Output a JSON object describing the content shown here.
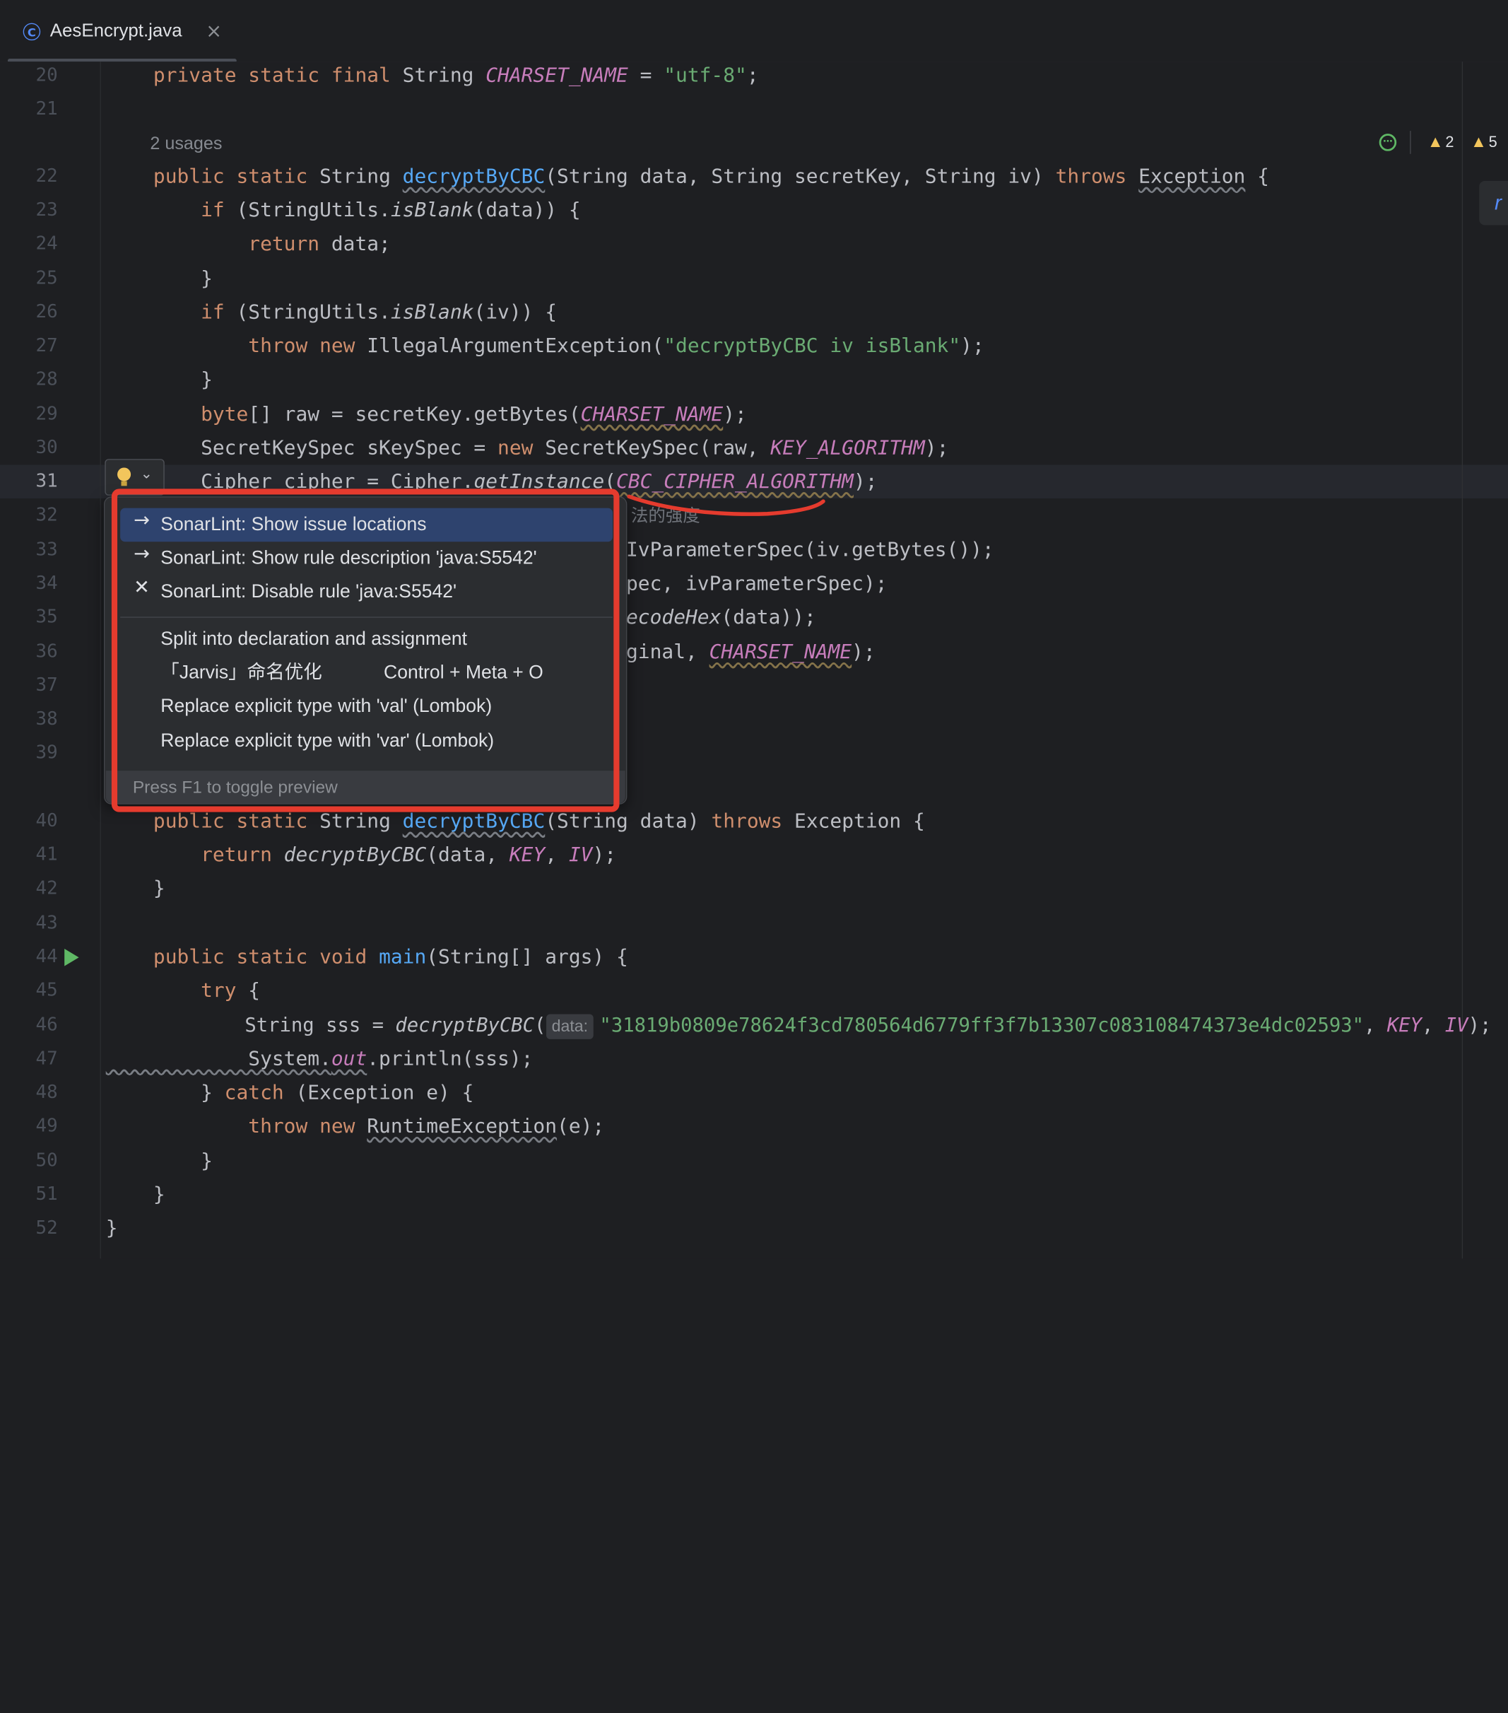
{
  "tab": {
    "title": "AesEncrypt.java",
    "icon": "java-class-icon",
    "close": "×"
  },
  "status": {
    "warnings": "2",
    "weak_warnings": "5"
  },
  "line_numbers": [
    "20",
    "21",
    "22",
    "23",
    "24",
    "25",
    "26",
    "27",
    "28",
    "29",
    "30",
    "31",
    "32",
    "33",
    "34",
    "35",
    "36",
    "37",
    "38",
    "39",
    "40",
    "41",
    "42",
    "43",
    "44",
    "45",
    "46",
    "47",
    "48",
    "49",
    "50",
    "51",
    "52"
  ],
  "current_line": "31",
  "hints": {
    "usages": "2 usages",
    "param_data": "data:"
  },
  "code": {
    "l20": {
      "a": "    ",
      "k": "private static final ",
      "t": "String ",
      "c": "CHARSET_NAME",
      "eq": " = ",
      "s": "\"utf-8\"",
      "e": ";"
    },
    "l22": {
      "k1": "    public static ",
      "t": "String ",
      "m": "decryptByCBC",
      "p1": "(String data, String secretKey, String iv) ",
      "k2": "throws ",
      "ex": "Exception",
      "e": " {"
    },
    "l23": {
      "k": "        if ",
      "a": "(StringUtils.",
      "i": "isBlank",
      "b": "(data)) {"
    },
    "l24": {
      "k": "            return ",
      "a": "data;"
    },
    "l25": "        }",
    "l26": {
      "k": "        if ",
      "a": "(StringUtils.",
      "i": "isBlank",
      "b": "(iv)) {"
    },
    "l27": {
      "k": "            throw new ",
      "a": "IllegalArgumentException(",
      "s": "\"decryptByCBC iv isBlank\"",
      "e": ");"
    },
    "l28": "        }",
    "l29": {
      "k": "        byte",
      "a": "[] raw = secretKey.getBytes(",
      "c": "CHARSET_NAME",
      "e": ");"
    },
    "l30": {
      "a": "        SecretKeySpec sKeySpec = ",
      "k": "new ",
      "b": "SecretKeySpec(raw, ",
      "c": "KEY_ALGORITHM",
      "e": ");"
    },
    "l31": {
      "a": "        Cipher cipher = Cipher.",
      "i": "getInstance",
      "b": "(",
      "c": "CBC_CIPHER_ALGORITHM",
      "e": ");"
    },
    "l32": "法的强度",
    "l33": "IvParameterSpec(iv.getBytes());",
    "l34": "pec, ivParameterSpec);",
    "l35": {
      "i": "ecodeHex",
      "e": "(data));"
    },
    "l36": {
      "a": "ginal, ",
      "c": "CHARSET_NAME",
      "e": ");"
    },
    "l40": {
      "k1": "    public static ",
      "t": "String ",
      "m": "decryptByCBC",
      "p": "(String data) ",
      "k2": "throws ",
      "e": "Exception {"
    },
    "l41": {
      "k": "        return ",
      "i": "decryptByCBC",
      "a": "(data, ",
      "c1": "KEY",
      "b": ", ",
      "c2": "IV",
      "e": ");"
    },
    "l42": "    }",
    "l44": {
      "k": "    public static void ",
      "m": "main",
      "a": "(String[] args) {"
    },
    "l45": {
      "k": "        try ",
      "a": "{"
    },
    "l46": {
      "a": "            String sss = ",
      "i": "decryptByCBC",
      "b": "(",
      "s": "\"31819b0809e78624f3cd780564d6779ff3f7b13307c083108474373e4dc02593\"",
      "c": ", ",
      "c1": "KEY",
      "d": ", ",
      "c2": "IV",
      "e": ");"
    },
    "l47": {
      "a": "            System.",
      "c": "out",
      "b": ".println(sss);"
    },
    "l48": {
      "a": "        } ",
      "k": "catch ",
      "b": "(Exception e) {"
    },
    "l49": {
      "k": "            throw new ",
      "a": "RuntimeException",
      "b": "(e);"
    },
    "l50": "        }",
    "l51": "    }",
    "l52": "}"
  },
  "popup": {
    "items": [
      {
        "icon": "→",
        "label": "SonarLint: Show issue locations"
      },
      {
        "icon": "→",
        "label": "SonarLint: Show rule description 'java:S5542'"
      },
      {
        "icon": "✕",
        "label": "SonarLint: Disable rule 'java:S5542'"
      },
      {
        "label": "Split into declaration and assignment"
      },
      {
        "label": "「Jarvis」命名优化",
        "shortcut": "Control + Meta + O"
      },
      {
        "label": "Replace explicit type with 'val' (Lombok)"
      },
      {
        "label": "Replace explicit type with 'var' (Lombok)"
      }
    ],
    "footer": "Press F1 to toggle preview"
  },
  "colors": {
    "keyword": "#cf8e6d",
    "string": "#6aab73",
    "constant": "#c77dbb",
    "method": "#56a8f5",
    "selection": "#2e436e",
    "annotation_red": "#e53b2e"
  }
}
